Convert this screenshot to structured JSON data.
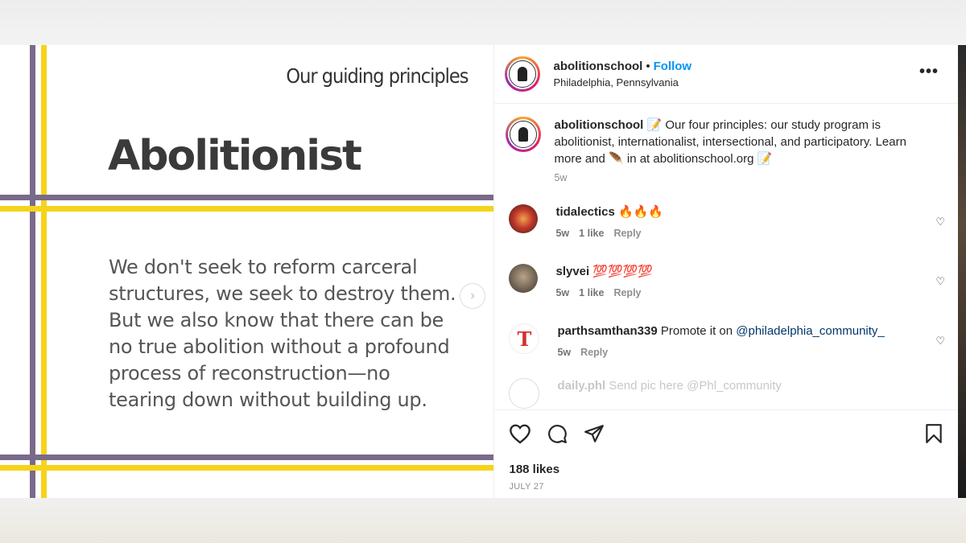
{
  "slide": {
    "title": "Our guiding principles",
    "heading": "Abolitionist",
    "body": "We don't seek to reform carceral structures, we seek to destroy them. But we also know that there can be no true abolition without a profound process of reconstruction—no tearing down without building up."
  },
  "post": {
    "username": "abolitionschool",
    "follow_label": "Follow",
    "location": "Philadelphia, Pennsylvania",
    "caption": {
      "username": "abolitionschool",
      "text": "📝 Our four principles: our study program is abolitionist, internationalist, intersectional, and participatory. Learn more and 🪶 in at abolitionschool.org 📝",
      "time": "5w"
    },
    "comments": [
      {
        "username": "tidalectics",
        "text": "🔥🔥🔥",
        "time": "5w",
        "likes": "1 like",
        "reply": "Reply"
      },
      {
        "username": "slyvei",
        "text": "💯💯💯💯",
        "time": "5w",
        "likes": "1 like",
        "reply": "Reply"
      },
      {
        "username": "parthsamthan339",
        "text": "Promote it on",
        "mention": "@philadelphia_community_",
        "time": "5w",
        "reply": "Reply"
      },
      {
        "username": "daily.phl",
        "text": "Send pic here",
        "mention": "@Phl_community"
      }
    ],
    "likes": "188 likes",
    "date": "JULY 27"
  },
  "colors": {
    "purple_stripe": "#7a6a8a",
    "yellow_stripe": "#f5d31c",
    "follow_blue": "#0095f6"
  },
  "icons": [
    "more-icon",
    "heart-icon",
    "comment-icon",
    "share-icon",
    "bookmark-icon",
    "chevron-right-icon"
  ]
}
